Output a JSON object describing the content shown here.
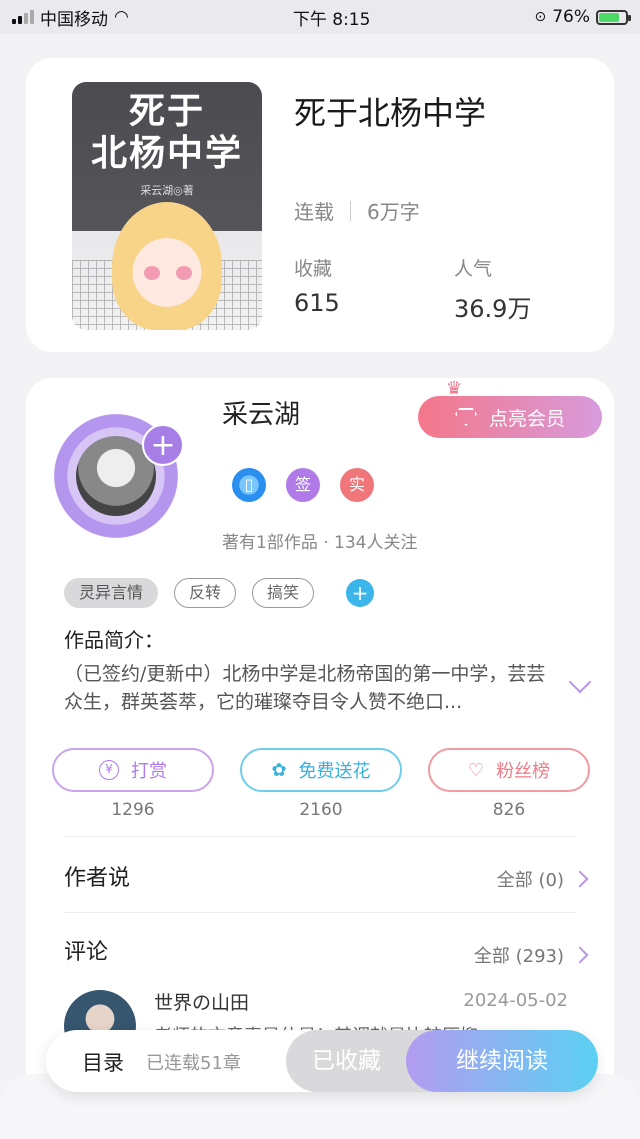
{
  "status_bar": {
    "carrier": "中国移动",
    "time": "下午 8:15",
    "battery": "76%"
  },
  "book": {
    "cover_title_line1": "死于",
    "cover_title_line2": "北杨中学",
    "cover_author": "采云湖◎著",
    "title": "死于北杨中学",
    "status": "连载",
    "word_count": "6万字",
    "favorites_label": "收藏",
    "favorites_value": "615",
    "popularity_label": "人气",
    "popularity_value": "36.9万"
  },
  "author": {
    "name": "采云湖",
    "vip_button": "点亮会员",
    "badge_sign": "签",
    "badge_real": "实",
    "stats": "著有1部作品 · 134人关注"
  },
  "tags": [
    "灵异言情",
    "反转",
    "搞笑"
  ],
  "intro": {
    "label": "作品简介：",
    "text": "（已签约/更新中）北杨中学是北杨帝国的第一中学，芸芸众生，群英荟萃，它的璀璨夺目令人赞不绝口..."
  },
  "actions": {
    "tip_label": "打赏",
    "tip_count": "1296",
    "flower_label": "免费送花",
    "flower_count": "2160",
    "fans_label": "粉丝榜",
    "fans_count": "826"
  },
  "author_says": {
    "title": "作者说",
    "all": "全部 (0)"
  },
  "comments": {
    "title": "评论",
    "all": "全部 (293)",
    "first_user": "世界の山田",
    "first_date": "2024-05-02",
    "first_text": "老师的文章真是什是！其调就是比较压抑"
  },
  "bottom": {
    "toc": "目录",
    "toc_sub": "已连载51章",
    "favorited": "已收藏",
    "continue_reading": "继续阅读"
  },
  "colors": {
    "accent_purple": "#b07be8",
    "accent_blue": "#37b1dc",
    "accent_pink": "#ec7c87"
  }
}
